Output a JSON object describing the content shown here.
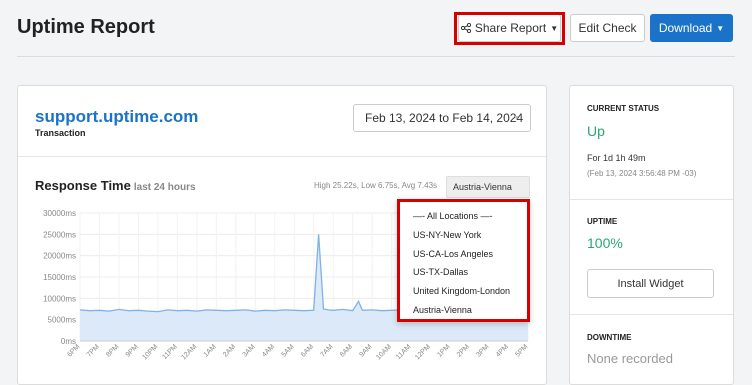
{
  "header": {
    "title": "Uptime Report",
    "share_label": "Share Report",
    "edit_label": "Edit Check",
    "download_label": "Download"
  },
  "monitor": {
    "url": "support.uptime.com",
    "type": "Transaction",
    "date_range": "Feb 13, 2024 to Feb 14, 2024"
  },
  "response_time": {
    "title": "Response Time",
    "subtitle": "last 24 hours",
    "stats": "High 25.22s, Low 6.75s, Avg 7.43s",
    "selected_location": "Austria-Vienna",
    "locations": [
      "—- All Locations —-",
      "US-NY-New York",
      "US-CA-Los Angeles",
      "US-TX-Dallas",
      "United Kingdom-London",
      "Austria-Vienna"
    ]
  },
  "chart_data": {
    "type": "area",
    "title": "",
    "xlabel": "",
    "ylabel": "",
    "y_ticks": [
      "0ms",
      "5000ms",
      "10000ms",
      "15000ms",
      "20000ms",
      "25000ms",
      "30000ms"
    ],
    "ylim": [
      0,
      30000
    ],
    "x_ticks": [
      "6PM",
      "7PM",
      "8PM",
      "9PM",
      "10PM",
      "11PM",
      "12AM",
      "1AM",
      "2AM",
      "3AM",
      "4AM",
      "5AM",
      "6AM",
      "7AM",
      "8AM",
      "9AM",
      "10AM",
      "11AM",
      "12PM",
      "1PM",
      "2PM",
      "3PM",
      "4PM",
      "5PM"
    ],
    "x": [
      0,
      0.5,
      1,
      1.5,
      2,
      2.5,
      3,
      3.5,
      4,
      4.5,
      5,
      5.5,
      6,
      6.5,
      7,
      7.5,
      8,
      8.5,
      9,
      9.5,
      10,
      10.5,
      11,
      11.5,
      12,
      12.25,
      12.5,
      12.75,
      13,
      13.5,
      14,
      14.3,
      14.5,
      15,
      15.5,
      16,
      16.5,
      17,
      17.5,
      18,
      18.5,
      19,
      19.5,
      20,
      20.5,
      21,
      21.5,
      22,
      22.5,
      23
    ],
    "y_ms": [
      7300,
      7100,
      7200,
      7000,
      7400,
      7100,
      7200,
      7000,
      6900,
      7300,
      7100,
      7200,
      7000,
      7300,
      7200,
      7100,
      7200,
      7300,
      7000,
      7200,
      7100,
      7300,
      7200,
      7100,
      7200,
      25000,
      7500,
      7300,
      7200,
      7400,
      7100,
      9300,
      7200,
      7300,
      7100,
      7200,
      7300,
      7100,
      7200,
      7300,
      7200,
      7100,
      7300,
      7200,
      7100,
      7300,
      7200,
      7100,
      7200,
      7300
    ],
    "grid": true,
    "color": "#7fb2e5"
  },
  "sidebar": {
    "status_label": "CURRENT STATUS",
    "status_value": "Up",
    "status_duration": "For 1d 1h 49m",
    "status_since": "(Feb 13, 2024 3:56:48 PM -03)",
    "uptime_label": "UPTIME",
    "uptime_value": "100%",
    "widget_label": "Install Widget",
    "downtime_label": "DOWNTIME",
    "downtime_value": "None recorded"
  }
}
